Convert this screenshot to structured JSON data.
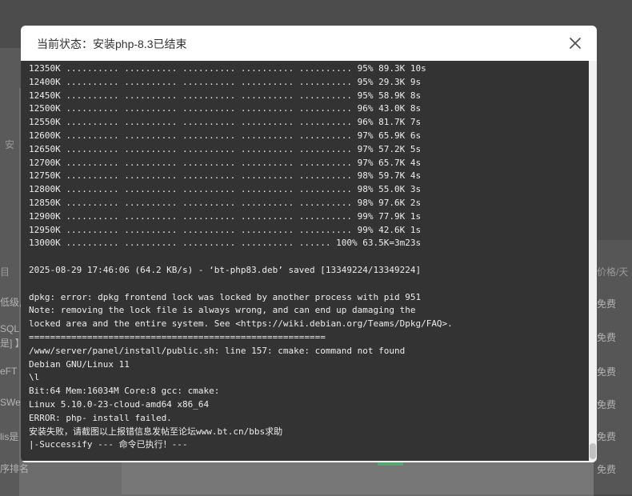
{
  "background": {
    "left_labels": [
      "安",
      "目",
      "低级,",
      "SQL",
      "是] 】",
      "eFT",
      "SWe",
      "lis是",
      "序排名"
    ],
    "right_labels": [
      "价格/天",
      "免费",
      "免费",
      "免费",
      "免费",
      "免费",
      "免费"
    ]
  },
  "modal": {
    "title": "当前状态：安装php-8.3已结束",
    "close_icon": "close-icon"
  },
  "terminal": {
    "lines": [
      "12350K .......... .......... .......... .......... .......... 95% 89.3K 10s",
      "12400K .......... .......... .......... .......... .......... 95% 29.3K 9s",
      "12450K .......... .......... .......... .......... .......... 95% 58.9K 8s",
      "12500K .......... .......... .......... .......... .......... 96% 43.0K 8s",
      "12550K .......... .......... .......... .......... .......... 96% 81.7K 7s",
      "12600K .......... .......... .......... .......... .......... 97% 65.9K 6s",
      "12650K .......... .......... .......... .......... .......... 97% 57.2K 5s",
      "12700K .......... .......... .......... .......... .......... 97% 65.7K 4s",
      "12750K .......... .......... .......... .......... .......... 98% 59.7K 4s",
      "12800K .......... .......... .......... .......... .......... 98% 55.0K 3s",
      "12850K .......... .......... .......... .......... .......... 98% 97.6K 2s",
      "12900K .......... .......... .......... .......... .......... 99% 77.9K 1s",
      "12950K .......... .......... .......... .......... .......... 99% 42.6K 1s",
      "13000K .......... .......... .......... .......... ...... 100% 63.5K=3m23s",
      "",
      "2025-08-29 17:46:06 (64.2 KB/s) - ‘bt-php83.deb’ saved [13349224/13349224]",
      "",
      "dpkg: error: dpkg frontend lock was locked by another process with pid 951",
      "Note: removing the lock file is always wrong, and can end up damaging the",
      "locked area and the entire system. See <https://wiki.debian.org/Teams/Dpkg/FAQ>.",
      "========================================================",
      "/www/server/panel/install/public.sh: line 157: cmake: command not found",
      "Debian GNU/Linux 11",
      "\\l",
      "Bit:64 Mem:16034M Core:8 gcc: cmake:",
      "Linux 5.10.0-23-cloud-amd64 x86_64",
      "ERROR: php- install failed.",
      "安装失败，请截图以上报错信息发帖至论坛www.bt.cn/bbs求助",
      "|-Successify --- 命令已执行！---"
    ]
  }
}
